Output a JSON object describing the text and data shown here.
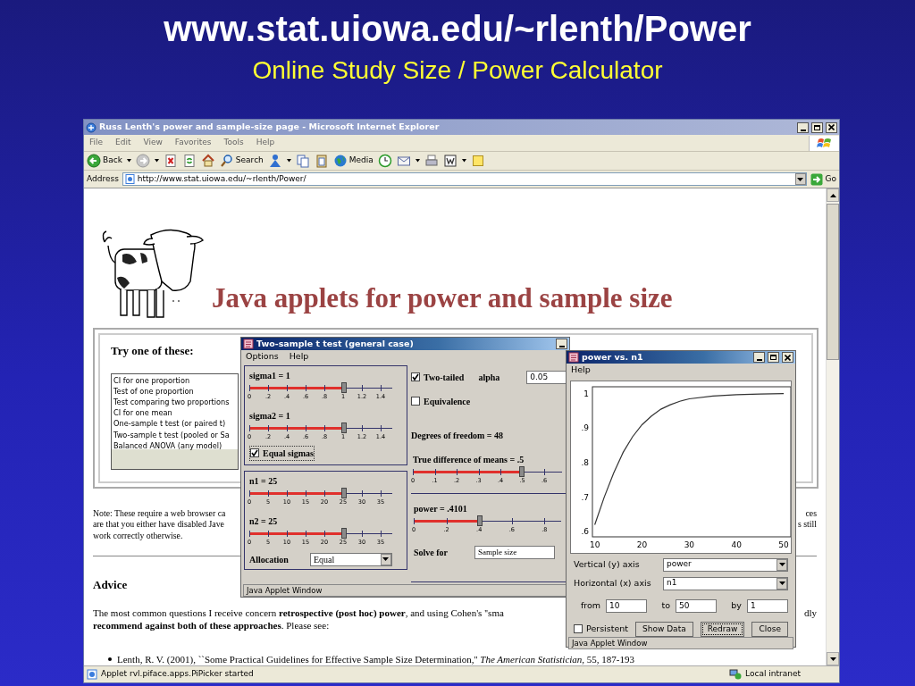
{
  "slide": {
    "title": "www.stat.uiowa.edu/~rlenth/Power",
    "subtitle": "Online Study Size / Power Calculator"
  },
  "browser": {
    "title": "Russ Lenth's power and sample-size page - Microsoft Internet Explorer",
    "menu": [
      "File",
      "Edit",
      "View",
      "Favorites",
      "Tools",
      "Help"
    ],
    "toolbar": [
      {
        "kind": "back",
        "label": "Back",
        "dropdown": true
      },
      {
        "kind": "forward",
        "dropdown": true
      },
      {
        "kind": "stop"
      },
      {
        "kind": "refresh"
      },
      {
        "kind": "home"
      },
      {
        "kind": "search",
        "label": "Search"
      },
      {
        "kind": "person",
        "dropdown": true
      },
      {
        "kind": "copy"
      },
      {
        "kind": "paste"
      },
      {
        "kind": "media",
        "label": "Media"
      },
      {
        "kind": "history"
      },
      {
        "kind": "mail",
        "dropdown": true
      },
      {
        "kind": "print"
      },
      {
        "kind": "document",
        "dropdown": true
      },
      {
        "kind": "note"
      }
    ],
    "address": {
      "label": "Address",
      "url": "http://www.stat.uiowa.edu/~rlenth/Power/",
      "go": "Go"
    },
    "status": {
      "text": "Applet rvl.piface.apps.PiPicker started",
      "zone": "Local intranet"
    }
  },
  "page": {
    "heading": "Java applets for power and sample size",
    "try_label": "Try one of these:",
    "applets": [
      "CI for one proportion",
      "Test of one proportion",
      "Test comparing two proportions",
      "CI for one mean",
      "One-sample t test (or paired t)",
      "Two-sample t test (pooled or Sa",
      "Balanced ANOVA (any model)"
    ],
    "note_lines": [
      "Note: These require a web browser ca",
      "are that you either have disabled Jave",
      "work correctly otherwise."
    ],
    "note_right": [
      "ces",
      "s still"
    ],
    "advice_heading": "Advice",
    "advice_lines": [
      "The most common questions I receive concern **retrospective (post hoc) power**, and using Cohen's ''sma",
      "**recommend against both of these approaches**.  Please see:"
    ],
    "advice_right": "dly",
    "references": [
      "Lenth, R. V. (2001), ``Some Practical Guidelines for Effective Sample Size Determination,'' *The American Statistician*, 55, 187-193"
    ]
  },
  "ttest_window": {
    "title": "Two-sample t test (general case)",
    "menu": [
      "Options",
      "Help"
    ],
    "sd_panel": {
      "sliders": [
        {
          "label": "sigma1 = 1",
          "ticks": [
            "0",
            ".2",
            ".4",
            ".6",
            ".8",
            "1",
            "1.2",
            "1.4"
          ],
          "level": 0.66
        },
        {
          "label": "sigma2 = 1",
          "ticks": [
            "0",
            ".2",
            ".4",
            ".6",
            ".8",
            "1",
            "1.2",
            "1.4"
          ],
          "level": 0.66
        }
      ],
      "equal_sigmas": {
        "label": "Equal sigmas",
        "checked": true
      }
    },
    "n_panel": {
      "sliders": [
        {
          "label": "n1 = 25",
          "ticks": [
            "0",
            "5",
            "10",
            "15",
            "20",
            "25",
            "30",
            "35"
          ],
          "level": 0.66
        },
        {
          "label": "n2 = 25",
          "ticks": [
            "0",
            "5",
            "10",
            "15",
            "20",
            "25",
            "30",
            "35"
          ],
          "level": 0.66
        }
      ],
      "allocation": {
        "label": "Allocation",
        "value": "Equal"
      }
    },
    "two_tailed": {
      "label": "Two-tailed",
      "checked": true
    },
    "alpha": {
      "label": "alpha",
      "value": "0.05"
    },
    "equivalence": {
      "label": "Equivalence",
      "checked": false
    },
    "df_text": "Degrees of freedom = 48",
    "diff_slider": {
      "label": "True difference of means = .5",
      "ticks": [
        "0",
        ".1",
        ".2",
        ".3",
        ".4",
        ".5",
        ".6"
      ],
      "level": 0.73
    },
    "power_panel": {
      "slider": {
        "label": "power = .4101",
        "ticks": [
          "0",
          ".2",
          ".4",
          ".6",
          ".8"
        ],
        "level": 0.45
      },
      "solve_for": {
        "label": "Solve for",
        "value": "Sample size"
      }
    },
    "status": "Java Applet Window"
  },
  "plot_window": {
    "title": "power vs. n1",
    "menu": [
      "Help"
    ],
    "chart_data": {
      "type": "line",
      "x": [
        10,
        12,
        14,
        16,
        18,
        20,
        22,
        24,
        26,
        28,
        30,
        35,
        40,
        45,
        50
      ],
      "series": [
        {
          "color": "#333333",
          "values": [
            0.62,
            0.7,
            0.77,
            0.83,
            0.875,
            0.91,
            0.935,
            0.955,
            0.968,
            0.978,
            0.985,
            0.993,
            0.997,
            0.999,
            1.0
          ]
        }
      ],
      "xlim": [
        9.5,
        51.5
      ],
      "ylim": [
        0.585,
        1.02
      ],
      "xticks": [
        10,
        20,
        30,
        40,
        50
      ],
      "yticks": [
        {
          "value": 0.6,
          "label": ".6"
        },
        {
          "value": 0.7,
          "label": ".7"
        },
        {
          "value": 0.8,
          "label": ".8"
        },
        {
          "value": 0.9,
          "label": ".9"
        },
        {
          "value": 1,
          "label": "1"
        }
      ]
    },
    "vertical_axis": {
      "label": "Vertical (y) axis",
      "value": "power"
    },
    "horizontal_axis": {
      "label": "Horizontal (x) axis",
      "value": "n1"
    },
    "range": [
      {
        "label": "from",
        "value": "10"
      },
      {
        "label": "to",
        "value": "50"
      },
      {
        "label": "by",
        "value": "1"
      }
    ],
    "persistent": {
      "label": "Persistent",
      "checked": false
    },
    "buttons": [
      {
        "label": "Show Data",
        "focused": false
      },
      {
        "label": "Redraw",
        "focused": true
      },
      {
        "label": "Close",
        "focused": false
      }
    ],
    "status": "Java Applet Window"
  }
}
